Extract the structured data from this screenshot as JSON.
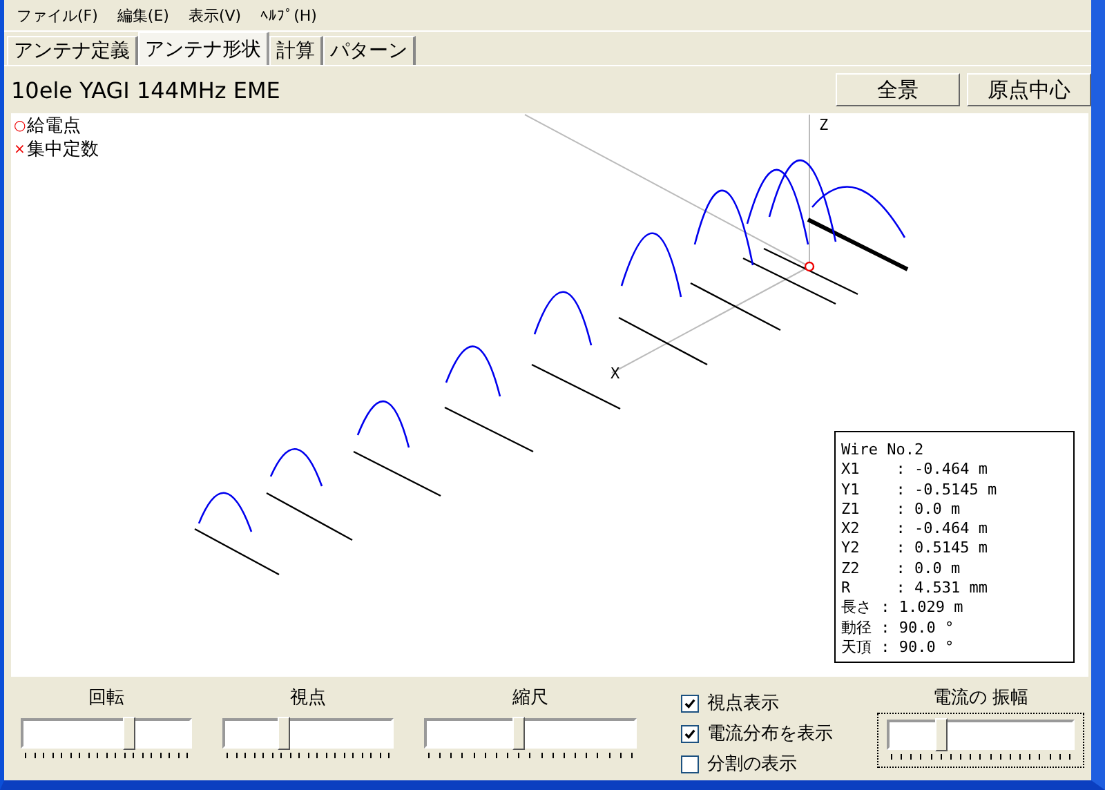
{
  "menu": [
    "ファイル(F)",
    "編集(E)",
    "表示(V)",
    "ﾍﾙﾌﾟ(H)"
  ],
  "tabs": [
    {
      "label": "アンテナ定義",
      "selected": false
    },
    {
      "label": "アンテナ形状",
      "selected": true
    },
    {
      "label": "計算",
      "selected": false
    },
    {
      "label": "パターン",
      "selected": false
    }
  ],
  "antenna_name": "10ele YAGI 144MHz EME",
  "buttons": [
    "全景",
    "原点中心"
  ],
  "legend": [
    {
      "symbol": "○",
      "label": "給電点"
    },
    {
      "symbol": "×",
      "label": "集中定数"
    }
  ],
  "axis_labels": {
    "z": "Z",
    "x": "X"
  },
  "wire_info": [
    "Wire No.2",
    "X1    : -0.464 m",
    "Y1    : -0.5145 m",
    "Z1    : 0.0 m",
    "X2    : -0.464 m",
    "Y2    : 0.5145 m",
    "Z2    : 0.0 m",
    "R     : 4.531 mm",
    "長さ : 1.029 m",
    "動径 : 90.0 °",
    "天頂 : 90.0 °"
  ],
  "sliders": [
    {
      "label": "回転",
      "level": 0.63
    },
    {
      "label": "視点",
      "level": 0.35
    },
    {
      "label": "縮尺",
      "level": 0.44
    }
  ],
  "checkboxes": [
    {
      "label": "視点表示",
      "checked": true
    },
    {
      "label": "電流分布を表示",
      "checked": true
    },
    {
      "label": "分割の表示",
      "checked": false
    }
  ],
  "amplitude_slider": {
    "label": "電流の 振幅",
    "level": 0.28,
    "framed": true
  }
}
